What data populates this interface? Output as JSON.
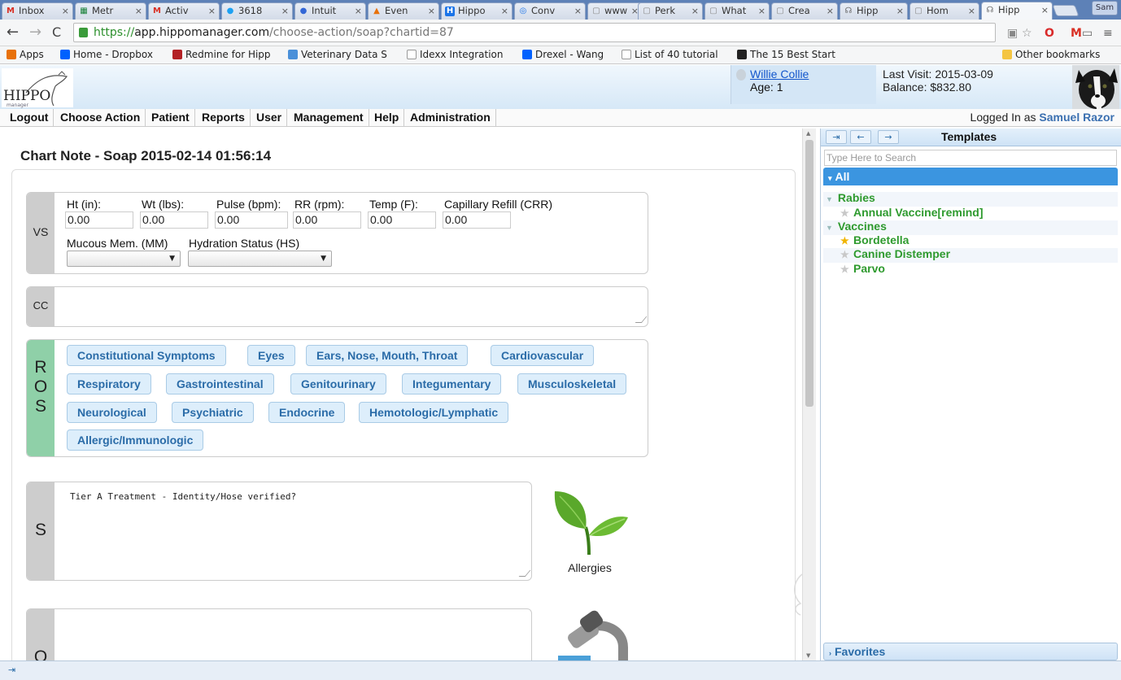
{
  "browser": {
    "tabs": [
      {
        "label": "Inbox",
        "color": "#d93025",
        "glyph": "M"
      },
      {
        "label": "Metr",
        "color": "#188038",
        "glyph": "▦"
      },
      {
        "label": "Activ",
        "color": "#d93025",
        "glyph": "M"
      },
      {
        "label": "3618",
        "color": "#1da1f2",
        "glyph": "🐦"
      },
      {
        "label": "Intuit",
        "color": "#3367d6",
        "glyph": "●"
      },
      {
        "label": "Even",
        "color": "#e8710a",
        "glyph": "🔥"
      },
      {
        "label": "Hippo",
        "color": "#1a73e8",
        "glyph": "H"
      },
      {
        "label": "Conv",
        "color": "#1a73e8",
        "glyph": "◎"
      },
      {
        "label": "www",
        "color": "#888888",
        "glyph": "▢"
      },
      {
        "label": "Perk",
        "color": "#888888",
        "glyph": "▢"
      },
      {
        "label": "What",
        "color": "#888888",
        "glyph": "▢"
      },
      {
        "label": "Crea",
        "color": "#888888",
        "glyph": "▢"
      },
      {
        "label": "Hipp",
        "color": "#888888",
        "glyph": "☊"
      },
      {
        "label": "Hom",
        "color": "#888888",
        "glyph": "▢"
      },
      {
        "label": "Hipp",
        "color": "#888888",
        "glyph": "☊"
      }
    ],
    "profile": "Sam",
    "url_scheme": "https://",
    "url_host": "app.hippomanager.com",
    "url_path": "/choose-action/soap?chartid=87",
    "bookmarks": [
      {
        "label": "Apps",
        "color": "#e8710a"
      },
      {
        "label": "Home - Dropbox",
        "color": "#0061fe"
      },
      {
        "label": "Redmine for Hipp",
        "color": "#b32024"
      },
      {
        "label": "Veterinary Data S",
        "color": "#4a90d9"
      },
      {
        "label": "Idexx Integration",
        "color": "#999999"
      },
      {
        "label": "Drexel - Wang",
        "color": "#0061fe"
      },
      {
        "label": "List of 40 tutorial",
        "color": "#999999"
      },
      {
        "label": "The 15 Best Start",
        "color": "#222222"
      }
    ],
    "other_bookmarks": "Other bookmarks"
  },
  "header": {
    "logo_text": "HIPPO",
    "logo_sub": "manager",
    "patient_name": "Willie Collie",
    "patient_age": "Age: 1",
    "last_visit": "Last Visit: 2015-03-09",
    "balance": "Balance: $832.80"
  },
  "menu": {
    "items": [
      "Logout",
      "Choose Action",
      "Patient",
      "Reports",
      "User",
      "Management",
      "Help",
      "Administration"
    ],
    "logged_in_prefix": "Logged In as",
    "logged_in_user": "Samuel Razor"
  },
  "chart": {
    "title": "Chart Note - Soap 2015-02-14 01:56:14",
    "vs_label": "VS",
    "vitals": [
      {
        "label": "Ht (in):",
        "value": "0.00"
      },
      {
        "label": "Wt (lbs):",
        "value": "0.00"
      },
      {
        "label": "Pulse (bpm):",
        "value": "0.00"
      },
      {
        "label": "RR (rpm):",
        "value": "0.00"
      },
      {
        "label": "Temp (F):",
        "value": "0.00"
      },
      {
        "label": "Capillary Refill (CRR)",
        "value": "0.00"
      }
    ],
    "mucous_label": "Mucous Mem. (MM)",
    "hydration_label": "Hydration Status (HS)",
    "cc_label": "CC",
    "ros_letters": [
      "R",
      "O",
      "S"
    ],
    "ros_buttons": [
      "Constitutional Symptoms",
      "Eyes",
      "Ears, Nose, Mouth, Throat",
      "Cardiovascular",
      "Respiratory",
      "Gastrointestinal",
      "Genitourinary",
      "Integumentary",
      "Musculoskeletal",
      "Neurological",
      "Psychiatric",
      "Endocrine",
      "Hemotologic/Lymphatic",
      "Allergic/Immunologic"
    ],
    "s_label": "S",
    "s_text": "Tier A Treatment - Identity/Hose verified?",
    "allergies_label": "Allergies",
    "o_label": "O"
  },
  "templates": {
    "title": "Templates",
    "search_placeholder": "Type Here to Search",
    "all_label": "All",
    "groups": [
      {
        "name": "Rabies",
        "items": [
          {
            "name": "Annual Vaccine[remind]",
            "starred": false
          }
        ]
      },
      {
        "name": "Vaccines",
        "items": [
          {
            "name": "Bordetella",
            "starred": true
          },
          {
            "name": "Canine Distemper",
            "starred": false
          },
          {
            "name": "Parvo",
            "starred": false
          }
        ]
      }
    ],
    "favorites_label": "Favorites"
  }
}
